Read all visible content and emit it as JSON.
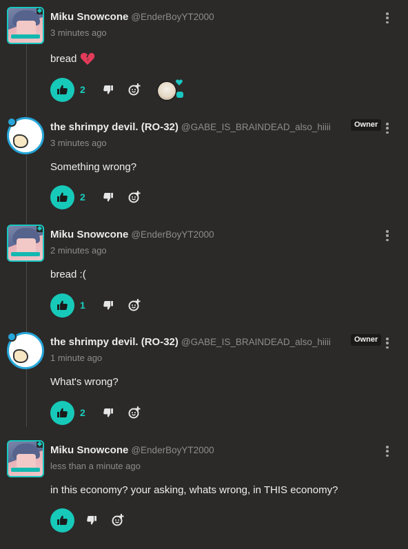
{
  "colors": {
    "background": "#2b2a29",
    "accent": "#17c9b9",
    "muted_text": "#8f8d8a",
    "owner_badge_bg": "#1b1a19"
  },
  "comments": [
    {
      "author": "Miku Snowcone",
      "handle": "@EnderBoyYT2000",
      "time": "3 minutes ago",
      "text": "bread",
      "emoji_icon": "broken-heart-icon",
      "likes": "2",
      "has_reaction": true
    },
    {
      "author": "the shrimpy devil. (RO-32)",
      "handle": "@GABE_IS_BRAINDEAD_also_hiiii",
      "time": "3 minutes ago",
      "text": "Something wrong?",
      "badge": "Owner",
      "likes": "2"
    },
    {
      "author": "Miku Snowcone",
      "handle": "@EnderBoyYT2000",
      "time": "2 minutes ago",
      "text": "bread :(",
      "likes": "1"
    },
    {
      "author": "the shrimpy devil. (RO-32)",
      "handle": "@GABE_IS_BRAINDEAD_also_hiiii",
      "time": "1 minute ago",
      "text": "What's wrong?",
      "badge": "Owner",
      "likes": "2"
    },
    {
      "author": "Miku Snowcone",
      "handle": "@EnderBoyYT2000",
      "time": "less than a minute ago",
      "text": "in this economy? your asking, whats wrong, in THIS economy?",
      "likes": ""
    }
  ],
  "icons": {
    "like": "thumbs-up-icon",
    "dislike": "thumbs-down-icon",
    "react": "add-reaction-icon",
    "more": "more-options-icon"
  }
}
